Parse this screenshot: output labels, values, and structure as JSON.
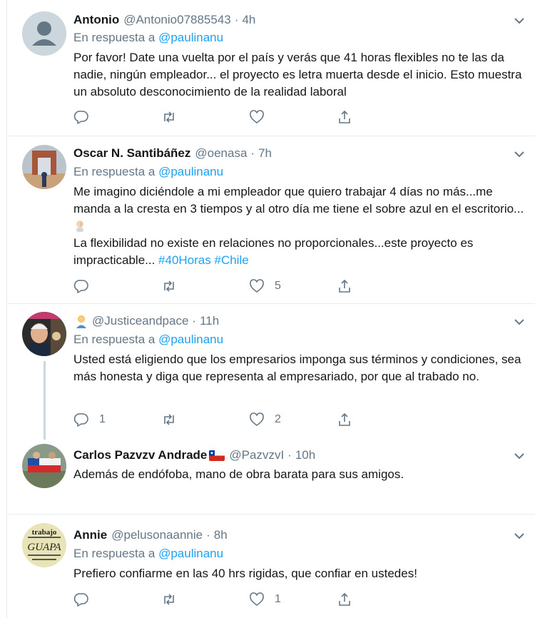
{
  "tweets": [
    {
      "name": "Antonio",
      "handle": "@Antonio07885543",
      "time": "4h",
      "reply_prefix": "En respuesta a",
      "reply_mention": "@paulinanu",
      "text": "Por favor! Date una vuelta por el país y verás que 41 horas flexibles no te las da nadie, ningún empleador... el proyecto es letra muerta desde el inicio. Esto muestra un absoluto desconocimiento de la realidad laboral",
      "replies": "",
      "retweets": "",
      "likes": ""
    },
    {
      "name": "Oscar N. Santibáñez",
      "handle": "@oenasa",
      "time": "7h",
      "reply_prefix": "En respuesta a",
      "reply_mention": "@paulinanu",
      "text_line1": "Me imagino diciéndole a mi empleador que quiero trabajar 4 días no más...me manda a la cresta en 3 tiempos y al otro día me tiene el sobre azul en el escritorio... ",
      "text_line2": "La flexibilidad no existe en relaciones no proporcionales...este proyecto es impracticable... ",
      "hashtag1": "#40Horas",
      "hashtag2": "#Chile",
      "replies": "",
      "retweets": "",
      "likes": "5"
    },
    {
      "name": "",
      "handle": "@Justiceandpace",
      "time": "11h",
      "reply_prefix": "En respuesta a",
      "reply_mention": "@paulinanu",
      "text": "Usted está eligiendo que los empresarios imponga sus términos y condiciones, sea más honesta y diga que representa al empresariado, por que al trabado no.",
      "replies": "1",
      "retweets": "",
      "likes": "2"
    },
    {
      "name": "Carlos Pazvzv Andrade",
      "handle": "@PazvzvI",
      "time": "10h",
      "text": "Además de endófoba, mano de obra barata para sus amigos.",
      "replies": "",
      "retweets": "",
      "likes": ""
    },
    {
      "name": "Annie",
      "handle": "@pelusonaannie",
      "time": "8h",
      "reply_prefix": "En respuesta a",
      "reply_mention": "@paulinanu",
      "text": "Prefiero confiarme en las 40 hrs rigidas, que confiar en ustedes!",
      "replies": "",
      "retweets": "",
      "likes": "1"
    }
  ],
  "avatar_texts": {
    "annie_line1": "trabajo",
    "annie_line2": "GUAPA"
  },
  "separator_dot": "·",
  "colors": {
    "link": "#1da1f2",
    "muted": "#657786",
    "text": "#14171a",
    "border": "#e6ecf0",
    "thread": "#ccd6dd"
  },
  "icons": [
    "reply-icon",
    "retweet-icon",
    "like-icon",
    "share-icon",
    "caret-down-icon"
  ]
}
